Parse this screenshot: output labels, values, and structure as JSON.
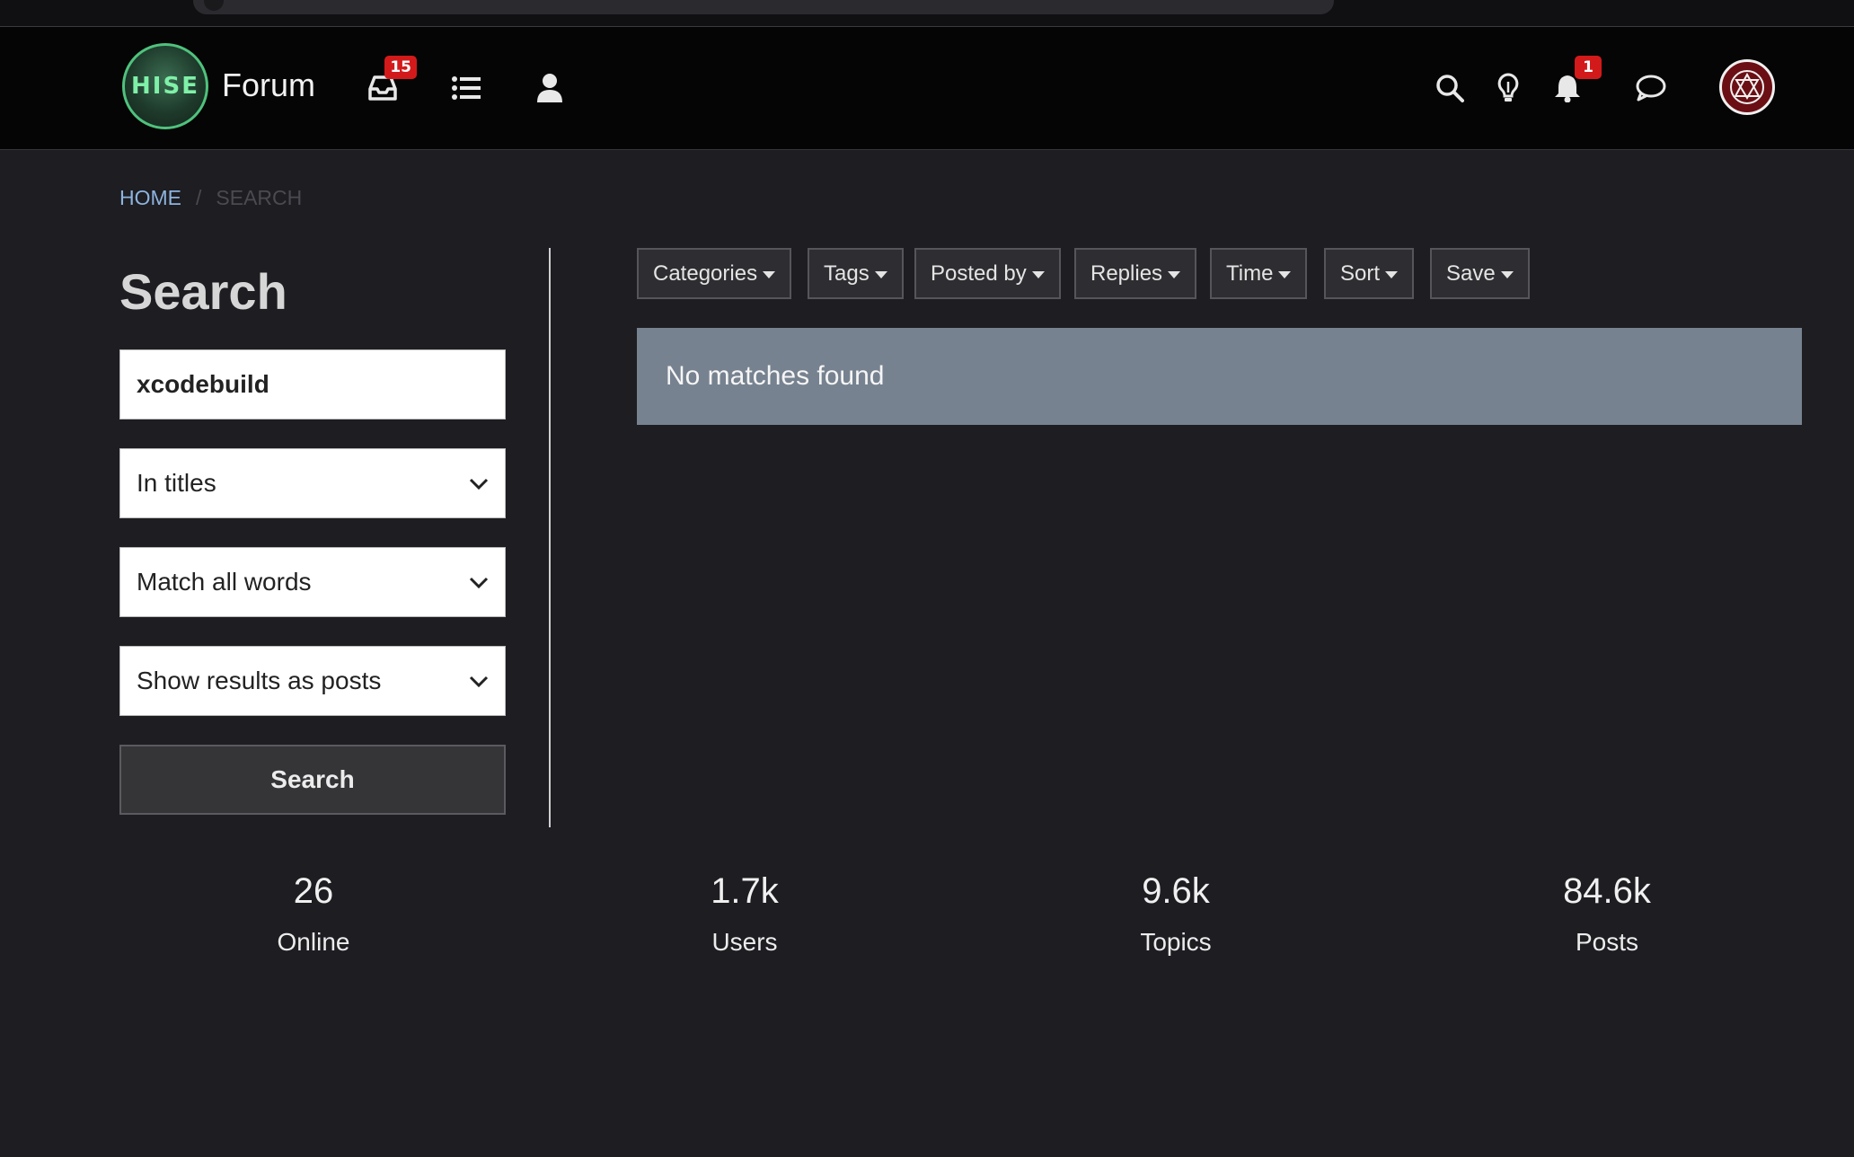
{
  "header": {
    "logo_text": "HISE",
    "brand_title": "Forum",
    "inbox_badge": "15",
    "notifications_badge": "1"
  },
  "breadcrumb": {
    "home": "HOME",
    "separator": "/",
    "current": "SEARCH"
  },
  "search": {
    "title": "Search",
    "query": "xcodebuild",
    "in_field": "In titles",
    "match_mode": "Match all words",
    "show_as": "Show results as posts",
    "button_label": "Search"
  },
  "filters": [
    "Categories",
    "Tags",
    "Posted by",
    "Replies",
    "Time",
    "Sort",
    "Save"
  ],
  "results": {
    "message": "No matches found"
  },
  "stats": [
    {
      "value": "26",
      "label": "Online"
    },
    {
      "value": "1.7k",
      "label": "Users"
    },
    {
      "value": "9.6k",
      "label": "Topics"
    },
    {
      "value": "84.6k",
      "label": "Posts"
    }
  ],
  "icons": {
    "inbox": "inbox-icon",
    "list": "list-icon",
    "user": "user-icon",
    "search": "search-icon",
    "bulb": "lightbulb-icon",
    "bell": "bell-icon",
    "chat": "chat-icon"
  },
  "colors": {
    "header_bg": "#050505",
    "page_bg": "#1d1d22",
    "accent_green": "#4fc27d",
    "badge_red": "#d31a1a",
    "alert_bg": "#778290",
    "link_blue": "#8eb3de"
  }
}
